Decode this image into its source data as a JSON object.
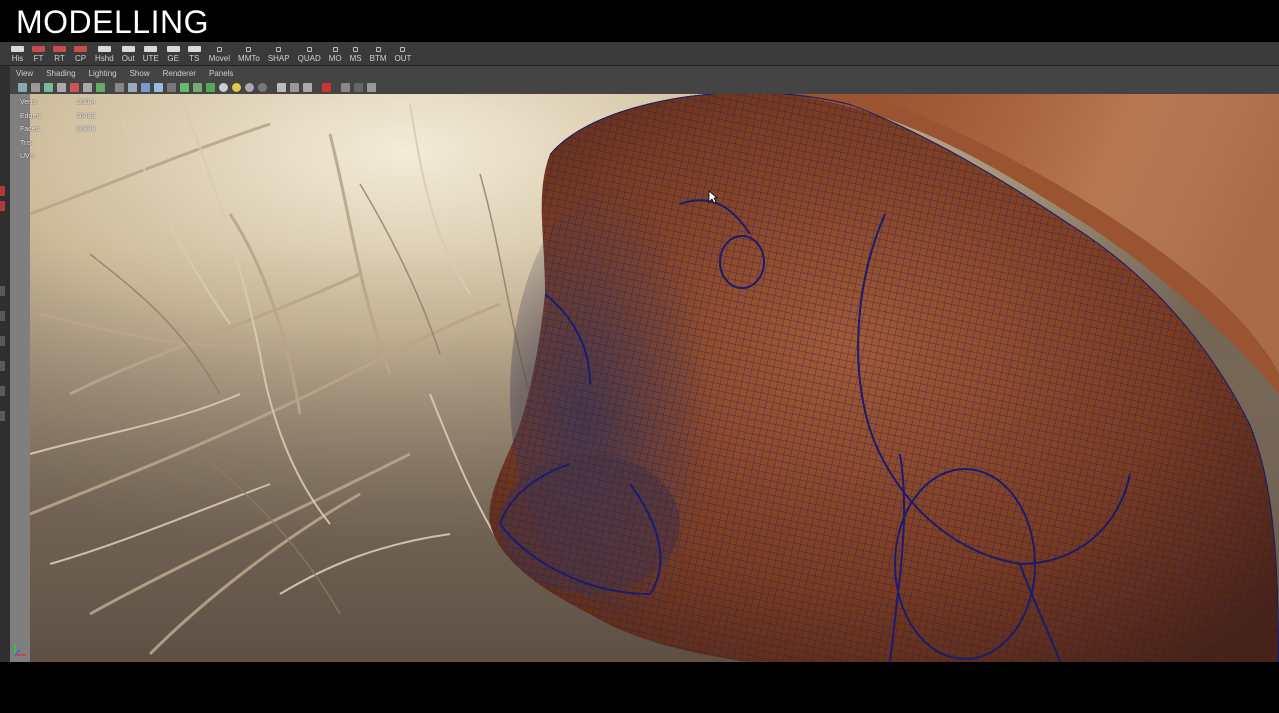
{
  "title": "MODELLING",
  "shelf_tabs": [
    "His",
    "FT",
    "RT",
    "CP",
    "Hshd",
    "Out",
    "UTE",
    "GE",
    "TS",
    "Movel",
    "MMTo",
    "SHAP",
    "QUAD",
    "MO",
    "MS",
    "BTM",
    "OUT"
  ],
  "panel_menu": [
    "View",
    "Shading",
    "Lighting",
    "Show",
    "Renderer",
    "Panels"
  ],
  "hud": {
    "verts": {
      "label": "Verts:",
      "value": "26264"
    },
    "edges": {
      "label": "Edges:",
      "value": "26482"
    },
    "faces": {
      "label": "Faces:",
      "value": "26330"
    },
    "tris": {
      "label": "Tris:",
      "value": ""
    },
    "uvs": {
      "label": "UVs:",
      "value": ""
    }
  },
  "colors": {
    "wireframe": "#1a1c6e",
    "fur": "#8a4a2a",
    "background_light": "#e8dcc2",
    "ui_panel": "#444444"
  },
  "icons": [
    "select-tool-icon",
    "camera-icon",
    "grid-icon",
    "wireframe-icon",
    "smooth-shade-icon",
    "texture-icon",
    "light-icon",
    "shadow-icon",
    "isolate-icon",
    "xray-icon"
  ]
}
